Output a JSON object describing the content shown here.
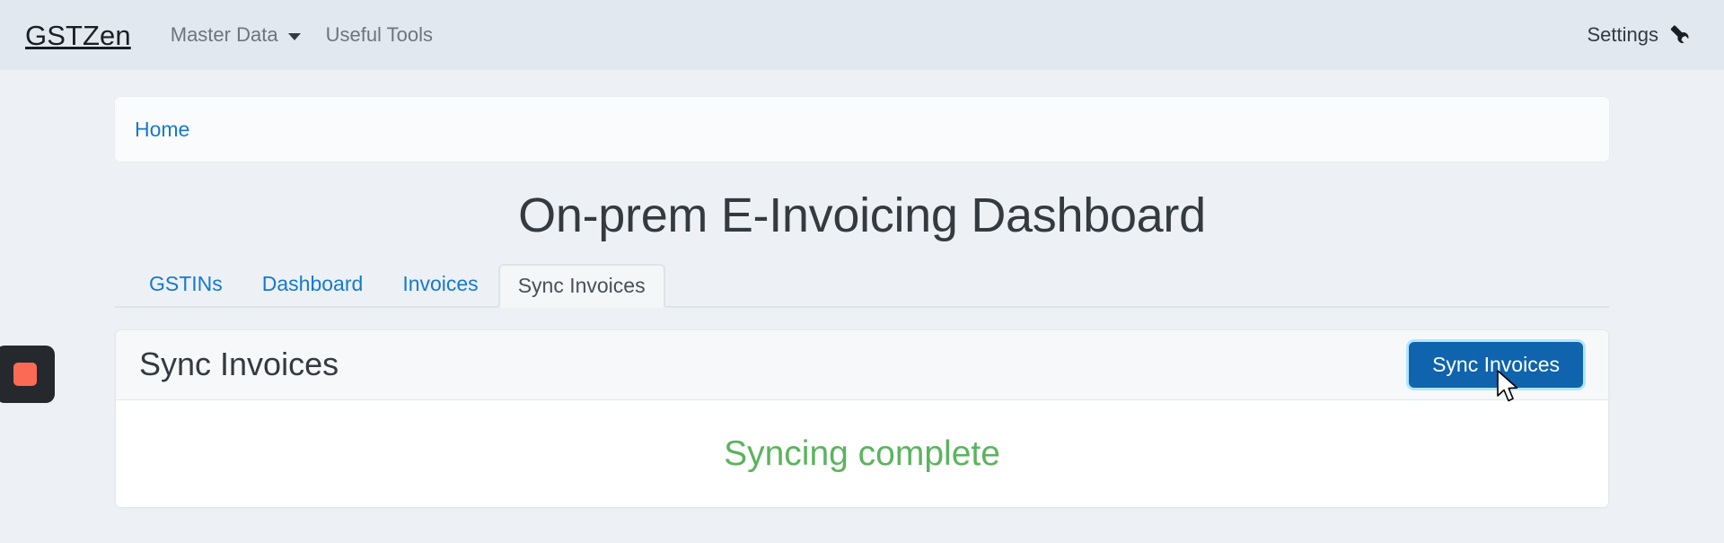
{
  "navbar": {
    "brand": "GSTZen",
    "links": [
      {
        "label": "Master Data",
        "has_caret": true,
        "icon": "chevron-down-icon"
      },
      {
        "label": "Useful Tools",
        "has_caret": false,
        "icon": ""
      }
    ],
    "settings": {
      "label": "Settings",
      "icon": "wrench-icon"
    }
  },
  "breadcrumb": {
    "items": [
      {
        "label": "Home"
      }
    ]
  },
  "page": {
    "title": "On-prem E-Invoicing Dashboard"
  },
  "tabs": [
    {
      "label": "GSTINs",
      "active": false
    },
    {
      "label": "Dashboard",
      "active": false
    },
    {
      "label": "Invoices",
      "active": false
    },
    {
      "label": "Sync Invoices",
      "active": true
    }
  ],
  "card": {
    "title": "Sync Invoices",
    "action_button": {
      "label": "Sync Invoices"
    },
    "status": {
      "message": "Syncing complete"
    }
  },
  "recorder": {
    "icon": "stop-recording-icon"
  },
  "cursor": {
    "icon": "mouse-pointer-icon"
  },
  "colors": {
    "navbar_bg": "#e2e8f0",
    "page_bg": "#edf1f5",
    "link_blue": "#1579d0",
    "primary_button": "#1064ad",
    "success_green": "#5cb35f",
    "recorder_bg": "#25282c",
    "recorder_stop": "#fc6a55"
  }
}
